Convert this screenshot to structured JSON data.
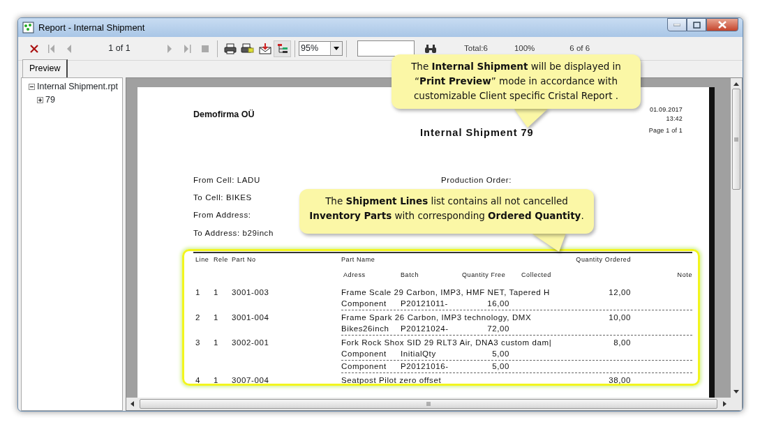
{
  "window": {
    "title": "Report - Internal Shipment"
  },
  "toolbar": {
    "page_indicator": "1 of 1",
    "zoom": "95%",
    "group_tree_on": true,
    "status": [
      "Total:6",
      "100%",
      "6 of 6"
    ]
  },
  "tabs": [
    {
      "label": "Preview",
      "selected": true
    }
  ],
  "tree": [
    {
      "label": "Internal Shipment.rpt",
      "expanded": true,
      "children": [
        {
          "label": "79",
          "expanded": false
        }
      ]
    }
  ],
  "report": {
    "company": "Demofirma OÜ",
    "title": "Internal Shipment  79",
    "date": "01.09.2017",
    "time": "13:42",
    "page": "Page 1 of 1",
    "fields": [
      "From Cell: LADU",
      "To Cell: BIKES",
      "From Address:",
      "To Address: b29inch"
    ],
    "production_order": "Production Order:",
    "columns": {
      "line": "Line",
      "rele": "Rele",
      "part_no": "Part No",
      "part_name": "Part Name",
      "quantity_ordered": "Quantity Ordered",
      "adress": "Adress",
      "batch": "Batch",
      "quantity_free": "Quantity Free",
      "collected": "Collected",
      "note": "Note"
    },
    "lines": [
      {
        "line": "1",
        "rele": "1",
        "part_no": "3001-003",
        "part_name": "Frame Scale 29 Carbon, IMP3, HMF NET, Tapered H",
        "quantity_ordered": "12,00",
        "sublines": [
          {
            "adress": "Component",
            "batch": "P20121011-",
            "quantity_free": "16,00"
          }
        ]
      },
      {
        "line": "2",
        "rele": "1",
        "part_no": "3001-004",
        "part_name": "Frame Spark 26 Carbon, IMP3 technology, DMX",
        "quantity_ordered": "10,00",
        "sublines": [
          {
            "adress": "Bikes26inch",
            "batch": "P20121024-",
            "quantity_free": "72,00"
          }
        ]
      },
      {
        "line": "3",
        "rele": "1",
        "part_no": "3002-001",
        "part_name": "Fork Rock Shox SID 29 RLT3 Air, DNA3 custom dam|",
        "quantity_ordered": "8,00",
        "sublines": [
          {
            "adress": "Component",
            "batch": "InitialQty",
            "quantity_free": "5,00"
          },
          {
            "adress": "Component",
            "batch": "P20121016-",
            "quantity_free": "5,00"
          }
        ]
      },
      {
        "line": "4",
        "rele": "1",
        "part_no": "3007-004",
        "part_name": "Seatpost Pilot zero offset",
        "quantity_ordered": "38,00"
      }
    ]
  },
  "callouts": [
    {
      "text": "The **Internal Shipment** will be displayed in “**Print Preview**” mode in accordance with customizable Client specific Cristal Report ."
    },
    {
      "text": "The **Shipment Lines** list contains all not cancelled **Inventory Parts** with corresponding **Ordered Quantity**."
    }
  ]
}
